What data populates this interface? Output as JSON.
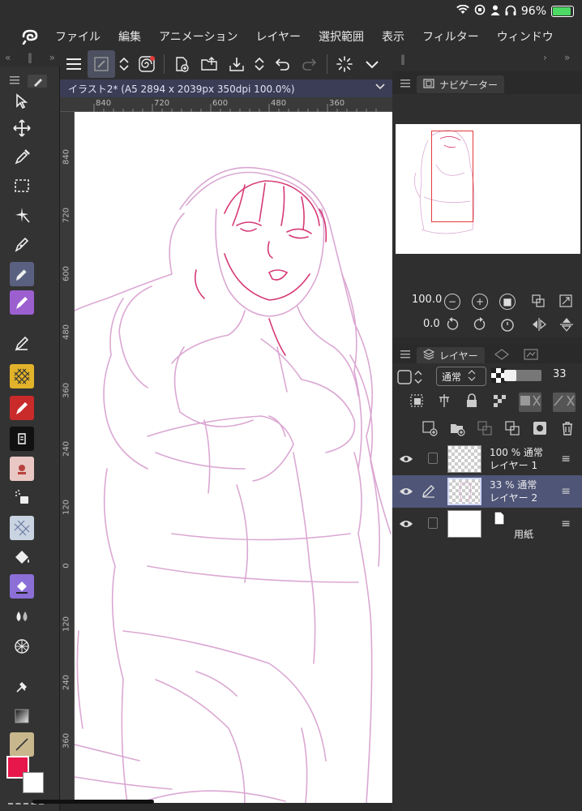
{
  "status": {
    "battery_text": "96%",
    "battery_level": 0.96,
    "battery_color": "#4cd964"
  },
  "menu": {
    "app_icon": "clip-studio-logo-icon",
    "items": [
      "ファイル",
      "編集",
      "アニメーション",
      "レイヤー",
      "選択範囲",
      "表示",
      "フィルター",
      "ウィンドウ"
    ]
  },
  "document": {
    "tab_title": "イラスト2* (A5 2894 x 2039px 350dpi 100.0%)"
  },
  "rulers": {
    "top_labels": [
      "840",
      "720",
      "600",
      "480",
      "360"
    ],
    "left_labels": [
      "840",
      "720",
      "600",
      "480",
      "360",
      "240",
      "120",
      "0",
      "120",
      "240",
      "360"
    ]
  },
  "navigator": {
    "tab_label": "ナビゲーター",
    "zoom_value": "100.0",
    "rotate_value": "0.0"
  },
  "layers": {
    "tab_label": "レイヤー",
    "blend_mode": "通常",
    "opacity_value": "33",
    "opacity_fraction": 0.33,
    "items": [
      {
        "line1": "100 % 通常",
        "line2": "レイヤー 1",
        "selected": false
      },
      {
        "line1": "33 % 通常",
        "line2": "レイヤー 2",
        "selected": true
      },
      {
        "line1": "",
        "line2": "用紙",
        "selected": false
      }
    ]
  },
  "colors": {
    "main_color": "#e8174b",
    "sub_color": "#ffffff",
    "accent": "#4e5577",
    "sketch_light": "#dba8d3",
    "sketch_dark": "#d63a76"
  }
}
